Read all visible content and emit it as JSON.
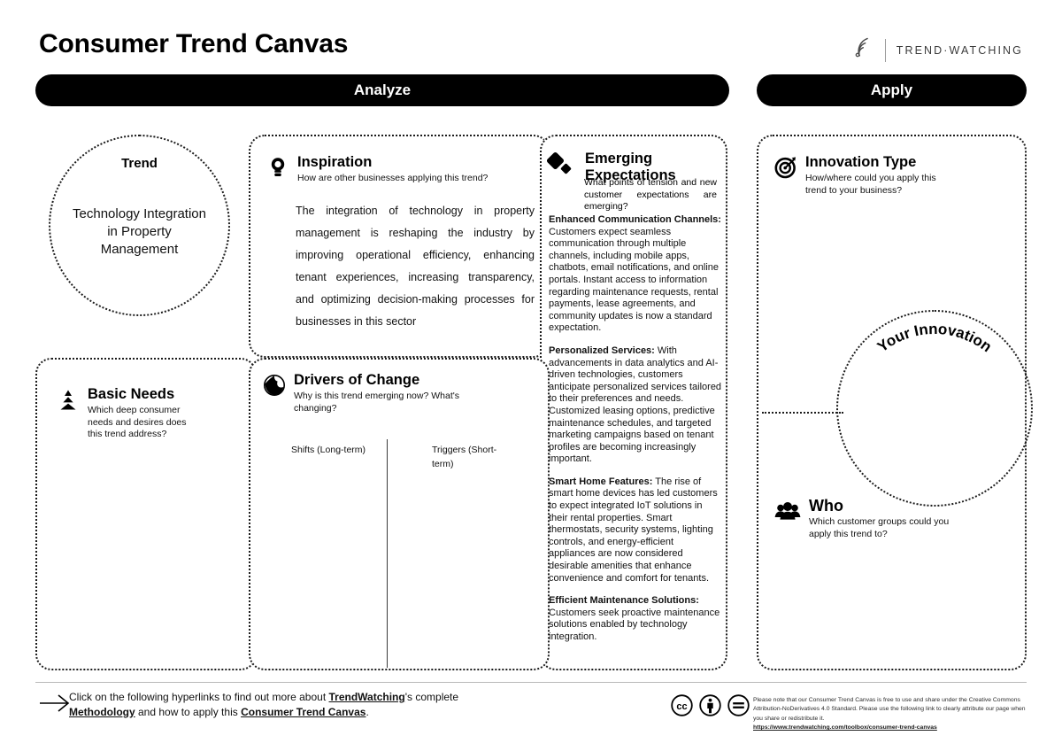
{
  "header": {
    "title": "Consumer Trend Canvas",
    "brand_icon": "signal-waves-icon",
    "brand_text": "TREND·WATCHING"
  },
  "sections": {
    "analyze_label": "Analyze",
    "apply_label": "Apply"
  },
  "trend": {
    "label": "Trend",
    "value": "Technology Integration in Property Management"
  },
  "inspiration": {
    "icon": "lightbulb-icon",
    "title": "Inspiration",
    "subtitle": "How are other businesses applying this trend?",
    "body": "The integration of technology in property management is reshaping the industry by improving operational efficiency, enhancing tenant experiences, increasing transparency, and optimizing decision-making processes for businesses in this sector"
  },
  "emerging": {
    "icon": "diamonds-icon",
    "title_line1": "Emerging",
    "title_line2": "Expectations",
    "subtitle": "What points of tension and new customer expectations are emerging?",
    "items": [
      {
        "heading": "Enhanced Communication Channels:",
        "text": " Customers expect seamless communication through multiple channels, including mobile apps, chatbots, email notifications, and online portals. Instant access to information regarding maintenance requests, rental payments, lease agreements, and community updates is now a standard expectation."
      },
      {
        "heading": "Personalized Services:",
        "text": " With advancements in data analytics and AI-driven technologies, customers anticipate personalized services tailored to their preferences and needs. Customized leasing options, predictive maintenance schedules, and targeted marketing campaigns based on tenant profiles are becoming increasingly important."
      },
      {
        "heading": "Smart Home Features:",
        "text": " The rise of smart home devices has led customers to expect integrated IoT solutions in their rental properties. Smart thermostats, security systems, lighting controls, and energy-efficient appliances are now considered desirable amenities that enhance convenience and comfort for tenants."
      },
      {
        "heading": "Efficient Maintenance Solutions:",
        "text": " Customers seek proactive maintenance solutions enabled by technology integration."
      }
    ]
  },
  "basic_needs": {
    "icon": "pyramid-icon",
    "title": "Basic Needs",
    "subtitle": "Which deep consumer needs and desires does this trend address?"
  },
  "drivers": {
    "icon": "globe-icon",
    "title": "Drivers of Change",
    "subtitle": "Why is this trend emerging now? What's changing?",
    "shifts_label": "Shifts (Long-term)",
    "triggers_label": "Triggers (Short-term)"
  },
  "innovation_type": {
    "icon": "target-arrow-icon",
    "title": "Innovation Type",
    "subtitle": "How/where could you apply this trend to your business?"
  },
  "your_innovation": {
    "label": "Your Innovation"
  },
  "who": {
    "icon": "people-group-icon",
    "title": "Who",
    "subtitle": "Which customer groups could you apply this trend to?"
  },
  "footer": {
    "arrow_icon": "arrow-right-icon",
    "line1_pre": "Click on the following hyperlinks to find out more about ",
    "line1_link": "TrendWatching",
    "line1_post": "'s complete",
    "line2_link1": "Methodology",
    "line2_mid": " and how to apply this ",
    "line2_link2": "Consumer Trend Canvas",
    "line2_post": ".",
    "cc_icons": [
      "cc-icon",
      "by-attribution-icon",
      "nd-noderivatives-icon"
    ],
    "license": "Please note that our Consumer Trend Canvas is free to use and share under the Creative Commons Attribution-NoDerivatives 4.0 Standard. Please use the following link to clearly attribute our page when you share or redistribute it.",
    "license_url": "https://www.trendwatching.com/toolbox/consumer-trend-canvas"
  },
  "colors": {
    "ink": "#000000",
    "paper": "#ffffff",
    "rule": "#b9b9b9"
  }
}
